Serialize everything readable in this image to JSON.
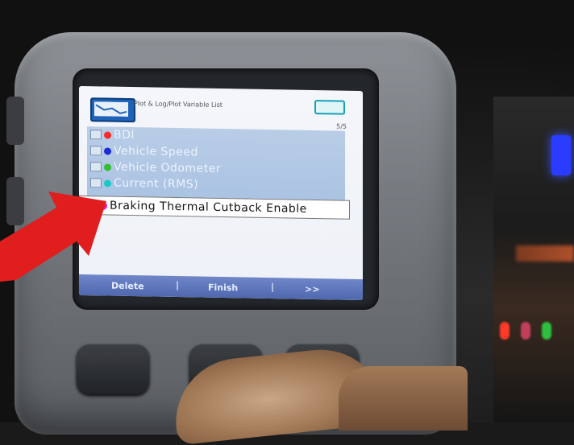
{
  "screen": {
    "header_title": "Plot & Log/Plot Variable List",
    "count": "5/5",
    "items": [
      {
        "label": "BDI",
        "dot_color": "#ff2a2a"
      },
      {
        "label": "Vehicle Speed",
        "dot_color": "#1b2bd8"
      },
      {
        "label": "Vehicle Odometer",
        "dot_color": "#2fbf2f"
      },
      {
        "label": "Current (RMS)",
        "dot_color": "#19c8c8"
      }
    ],
    "selected_item": {
      "label": "Braking Thermal Cutback Enable",
      "dot_color": "#e01ad2"
    },
    "footer": {
      "delete": "Delete",
      "finish": "Finish",
      "next": ">>"
    }
  },
  "colors": {
    "arrow": "#e01e1e",
    "header_icon": "#1f63b8",
    "footer": "#5a73b8"
  }
}
